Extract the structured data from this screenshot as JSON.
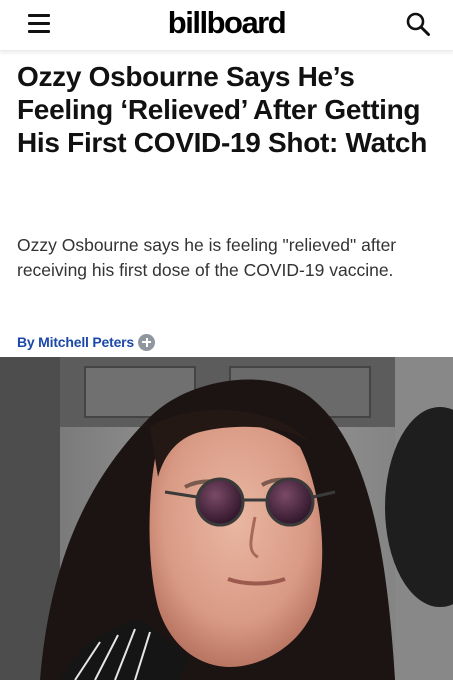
{
  "header": {
    "logo_text": "billboard",
    "menu_icon": "hamburger-menu-icon",
    "search_icon": "search-icon"
  },
  "article": {
    "headline": "Ozzy Osbourne Says He’s Feeling ‘Relieved’ After Getting His First COVID-19 Shot: Watch",
    "dek": "Ozzy Osbourne says he is feeling \"relieved\" after receiving his first dose of the COVID-19 vaccine.",
    "byline": "By Mitchell Peters",
    "byline_icon": "plus-circle-icon"
  },
  "colors": {
    "byline_blue": "#1c49a8",
    "headline": "#111111",
    "dek": "#333333"
  }
}
